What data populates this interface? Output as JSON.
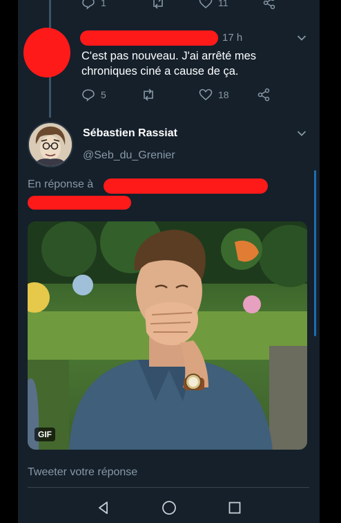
{
  "top_tweet_actions": {
    "reply_count": "1",
    "like_count": "11"
  },
  "tweet1": {
    "time": "17 h",
    "text_line1": "C'est pas nouveau. J'ai arrêté mes",
    "text_line2": "chroniques ciné a cause de ça.",
    "reply_count": "5",
    "like_count": "18"
  },
  "tweet2": {
    "name": "Sébastien Rassiat",
    "handle": "@Seb_du_Grenier",
    "reply_prefix": "En réponse à",
    "media_badge": "GIF"
  },
  "composer": {
    "placeholder": "Tweeter votre réponse"
  },
  "colors": {
    "background": "#15202b",
    "secondary_text": "#8899a6",
    "accent": "#1d6fb0",
    "redaction": "#ff1a1a"
  },
  "icons": [
    "reply-icon",
    "retweet-icon",
    "like-icon",
    "share-icon",
    "chevron-down-icon",
    "back-icon",
    "home-icon",
    "recents-icon"
  ]
}
